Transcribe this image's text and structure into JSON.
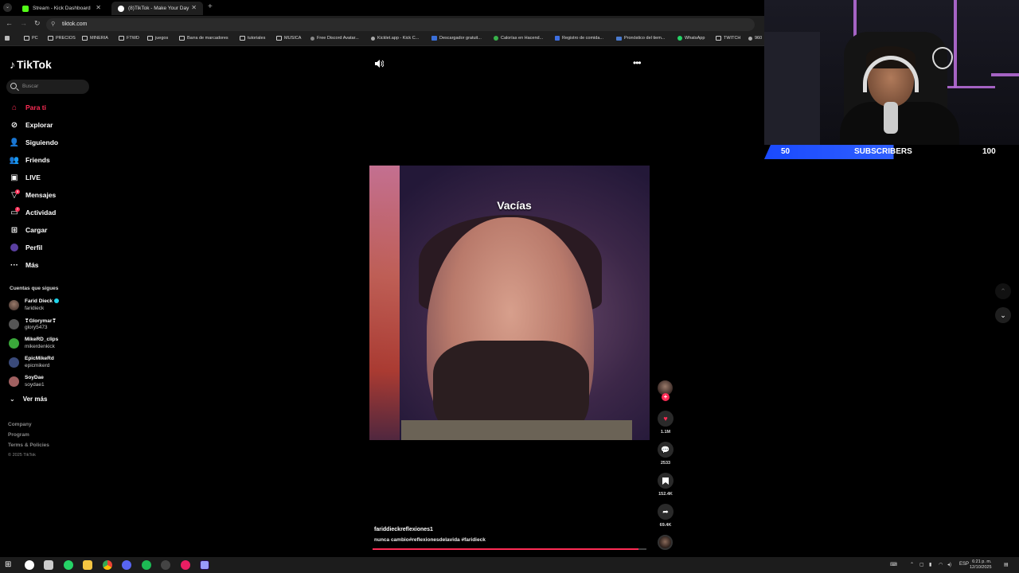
{
  "browser": {
    "tabs": [
      {
        "title": "Stream - Kick Dashboard",
        "active": false
      },
      {
        "title": "(8)TikTok - Make Your Day",
        "active": true
      }
    ],
    "url": "tiktok.com",
    "bookmarks": [
      "PC",
      "PRECIOS",
      "MINERIA",
      "FTWD",
      "juegos",
      "Barra de marcadores",
      "tutoriales",
      "MUSICA",
      "Free Discord Avatar...",
      "Kicklet.app - Kick C...",
      "Descargador gratuit...",
      "Calorías en Hacend...",
      "Registro de comida...",
      "Pronóstico del tiem...",
      "WhatsApp",
      "TWITCH",
      "960"
    ]
  },
  "tiktok": {
    "logo": "TikTok",
    "search_placeholder": "Buscar",
    "nav": [
      {
        "label": "Para ti",
        "icon": "home-icon",
        "active": true
      },
      {
        "label": "Explorar",
        "icon": "compass-icon"
      },
      {
        "label": "Siguiendo",
        "icon": "following-icon"
      },
      {
        "label": "Friends",
        "icon": "friends-icon"
      },
      {
        "label": "LIVE",
        "icon": "live-icon"
      },
      {
        "label": "Mensajes",
        "icon": "messages-icon",
        "badge": "3"
      },
      {
        "label": "Actividad",
        "icon": "activity-icon",
        "badge": "7"
      },
      {
        "label": "Cargar",
        "icon": "upload-icon"
      },
      {
        "label": "Perfil",
        "icon": "profile-icon"
      },
      {
        "label": "Más",
        "icon": "more-icon"
      }
    ],
    "following_title": "Cuentas que sigues",
    "following": [
      {
        "name": "Farid Dieck",
        "handle": "faridieck",
        "verified": true
      },
      {
        "name": "❣Glorymar❣",
        "handle": "glory5473"
      },
      {
        "name": "MikeRD_clips",
        "handle": "mikerdenkick"
      },
      {
        "name": "EpicMikeRd",
        "handle": "epicmikerd"
      },
      {
        "name": "SoyDae",
        "handle": "soydae1"
      }
    ],
    "ver_mas": "Ver más",
    "footer": [
      "Company",
      "Program",
      "Terms & Policies",
      "© 2025 TikTok"
    ],
    "video": {
      "overlay_text": "Vacías",
      "author": "fariddieckreflexiones1",
      "description": "nunca cambio#reflexionesdelavida  #faridieck",
      "likes": "1.1M",
      "comments": "2533",
      "saves": "152.4K",
      "shares": "69.4K",
      "progress": 0.97
    }
  },
  "webcam": {
    "sub_left": "50",
    "sub_label": "SUBSCRIBERS",
    "sub_right": "100",
    "sub_progress": 0.5
  },
  "taskbar": {
    "lang": "ESP",
    "time": "6:21 p. m.",
    "date": "12/10/2025"
  },
  "colors": {
    "accent": "#fe2c55",
    "sub_bar": "#2f5fff"
  }
}
